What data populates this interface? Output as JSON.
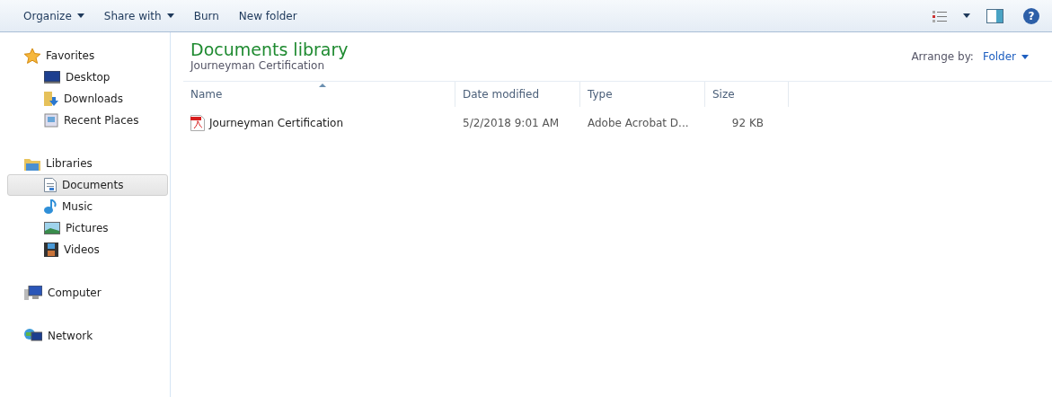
{
  "toolbar": {
    "buttons": [
      {
        "label": "Organize",
        "dropdown": true
      },
      {
        "label": "Share with",
        "dropdown": true
      },
      {
        "label": "Burn",
        "dropdown": false
      },
      {
        "label": "New folder",
        "dropdown": false
      }
    ],
    "help": "?"
  },
  "navigation": [
    {
      "label": "Favorites",
      "kind": "favorites",
      "selected": false,
      "children": [
        {
          "label": "Desktop",
          "kind": "desktop",
          "selected": false
        },
        {
          "label": "Downloads",
          "kind": "downloads",
          "selected": false
        },
        {
          "label": "Recent Places",
          "kind": "recent",
          "selected": false
        }
      ]
    },
    {
      "label": "Libraries",
      "kind": "libraries",
      "selected": false,
      "children": [
        {
          "label": "Documents",
          "kind": "documents",
          "selected": true
        },
        {
          "label": "Music",
          "kind": "music",
          "selected": false
        },
        {
          "label": "Pictures",
          "kind": "pictures",
          "selected": false
        },
        {
          "label": "Videos",
          "kind": "videos",
          "selected": false
        }
      ]
    },
    {
      "label": "Computer",
      "kind": "computer",
      "selected": false
    },
    {
      "label": "Network",
      "kind": "network",
      "selected": false
    }
  ],
  "library": {
    "title": "Documents library",
    "subtitle": "Journeyman Certification",
    "arrange_label": "Arrange by:",
    "arrange_value": "Folder"
  },
  "table": {
    "columns": [
      {
        "label": "Name",
        "sorted": true
      },
      {
        "label": "Date modified",
        "sorted": false
      },
      {
        "label": "Type",
        "sorted": false
      },
      {
        "label": "Size",
        "sorted": false
      }
    ],
    "rows": [
      {
        "name": "Journeyman Certification",
        "date_modified": "5/2/2018 9:01 AM",
        "type": "Adobe Acrobat D...",
        "size": "92 KB",
        "selected": false
      }
    ]
  }
}
